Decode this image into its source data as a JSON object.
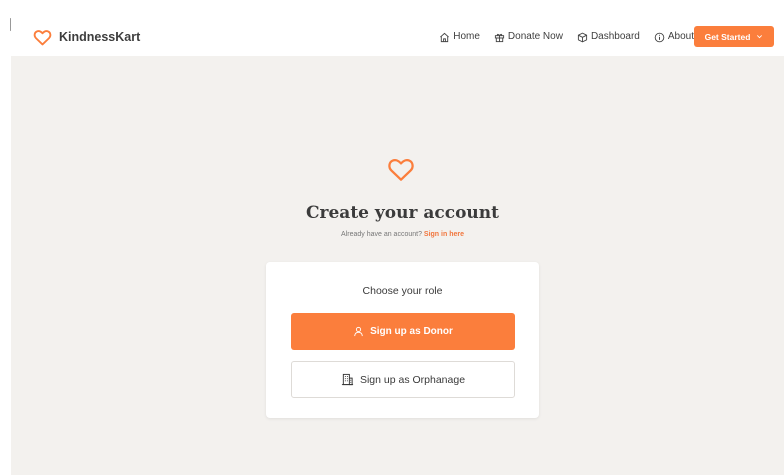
{
  "colors": {
    "accent": "#fb7e3c",
    "link": "#f1763d",
    "background": "#f3f1ee"
  },
  "brand": {
    "name": "KindnessKart",
    "icon": "heart-icon"
  },
  "nav": {
    "items": [
      {
        "label": "Home",
        "icon": "home-icon"
      },
      {
        "label": "Donate Now",
        "icon": "gift-icon"
      },
      {
        "label": "Dashboard",
        "icon": "box-icon"
      },
      {
        "label": "About",
        "icon": "info-icon"
      }
    ],
    "cta": {
      "label": "Get Started",
      "icon": "chevron-down-icon"
    }
  },
  "main": {
    "title": "Create your account",
    "subtitle_prefix": "Already have an account?",
    "signin_link": "Sign in here",
    "card": {
      "heading": "Choose your role",
      "donor_button": {
        "label": "Sign up as Donor",
        "icon": "user-icon"
      },
      "orphanage_button": {
        "label": "Sign up as Orphanage",
        "icon": "building-icon"
      }
    }
  }
}
